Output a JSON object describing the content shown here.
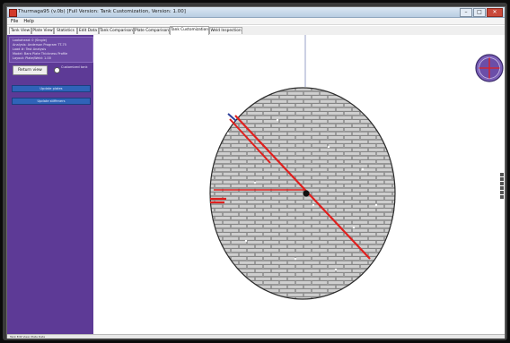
{
  "window": {
    "title": "Thurmaga95 (v.0b) [Full Version: Tank Customization, Version: 1.00]",
    "app_icon": "app-icon",
    "buttons": {
      "minimize": "–",
      "maximize": "□",
      "close": "✕"
    }
  },
  "menu": [
    "File",
    "Help"
  ],
  "tabs": [
    "Tank View",
    "Plate View",
    "Statistics",
    "Edit Data",
    "Tank Comparison",
    "Plate Comparison",
    "Tank Customization",
    "Weld Inspection"
  ],
  "active_tab": "Tank Customization",
  "sidebar": {
    "info_lines": [
      "Lookahead: 0 (Single)",
      "Analysis: Anderson Program TT-75",
      "Load #: Test Analysis",
      "Model: Bara Plate Thickness Profile",
      "Layout: Plate/Weld: 1.00"
    ],
    "return_button": "Return view",
    "radio_label": "Customized tank",
    "button_1": "Update plates",
    "button_2": "Update stiffeners"
  },
  "status": {
    "text": "Tank Edit View: Plate Data"
  },
  "colors": {
    "sidebar": "#5d3a96",
    "accent_line": "#e0201e",
    "plate_fill": "#a9a9a9",
    "compass": "#6b4ea8"
  },
  "compass_icon": "compass-icon"
}
